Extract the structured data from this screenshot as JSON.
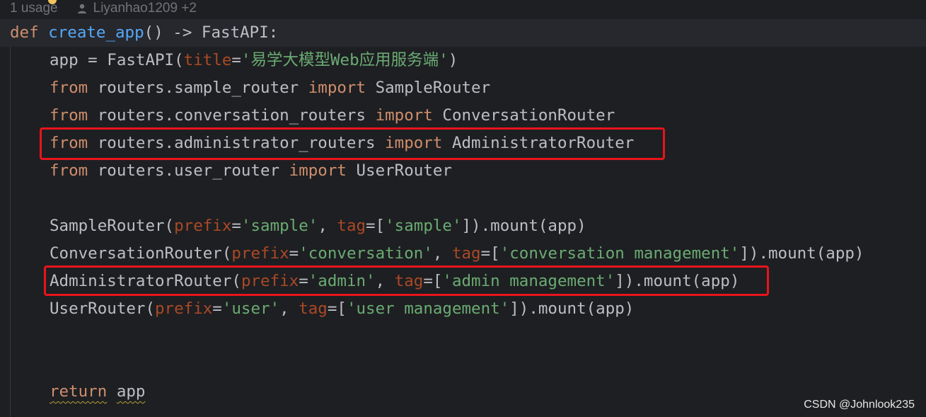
{
  "inlay_hint": {
    "usages": "1 usage",
    "authors": "Liyanhao1209 +2",
    "icons": [
      "bulb-icon",
      "user-icon"
    ]
  },
  "editor": {
    "lines": [
      {
        "tokens": [
          {
            "t": "def",
            "k": "kw"
          },
          {
            "t": " ",
            "k": ""
          },
          {
            "t": "create_app",
            "k": "fn"
          },
          {
            "t": "() -> FastAPI:",
            "k": ""
          }
        ]
      },
      {
        "indent": true,
        "tokens": [
          {
            "t": "app = FastAPI(",
            "k": ""
          },
          {
            "t": "title",
            "k": "param"
          },
          {
            "t": "=",
            "k": ""
          },
          {
            "t": "'",
            "k": "str"
          },
          {
            "t": "易学大模型",
            "k": "str cn"
          },
          {
            "t": "Web",
            "k": "str"
          },
          {
            "t": "应用服务端",
            "k": "str cn"
          },
          {
            "t": "'",
            "k": "str"
          },
          {
            "t": ")",
            "k": ""
          }
        ]
      },
      {
        "indent": true,
        "tokens": [
          {
            "t": "from",
            "k": "kw"
          },
          {
            "t": " routers.sample_router ",
            "k": ""
          },
          {
            "t": "import",
            "k": "kw"
          },
          {
            "t": " SampleRouter",
            "k": ""
          }
        ]
      },
      {
        "indent": true,
        "tokens": [
          {
            "t": "from",
            "k": "kw"
          },
          {
            "t": " routers.conversation_routers ",
            "k": ""
          },
          {
            "t": "import",
            "k": "kw"
          },
          {
            "t": " ConversationRouter",
            "k": ""
          }
        ]
      },
      {
        "indent": true,
        "tokens": [
          {
            "t": "from",
            "k": "kw"
          },
          {
            "t": " routers.administrator_routers ",
            "k": ""
          },
          {
            "t": "import",
            "k": "kw"
          },
          {
            "t": " AdministratorRouter",
            "k": ""
          }
        ]
      },
      {
        "indent": true,
        "tokens": [
          {
            "t": "from",
            "k": "kw"
          },
          {
            "t": " routers.user_router ",
            "k": ""
          },
          {
            "t": "import",
            "k": "kw"
          },
          {
            "t": " UserRouter",
            "k": ""
          }
        ]
      },
      {
        "tokens": []
      },
      {
        "indent": true,
        "tokens": [
          {
            "t": "SampleRouter(",
            "k": ""
          },
          {
            "t": "prefix",
            "k": "param"
          },
          {
            "t": "=",
            "k": ""
          },
          {
            "t": "'sample'",
            "k": "str"
          },
          {
            "t": ", ",
            "k": ""
          },
          {
            "t": "tag",
            "k": "param"
          },
          {
            "t": "=[",
            "k": ""
          },
          {
            "t": "'sample'",
            "k": "str"
          },
          {
            "t": "]).mount(app)",
            "k": ""
          }
        ]
      },
      {
        "indent": true,
        "tokens": [
          {
            "t": "ConversationRouter(",
            "k": ""
          },
          {
            "t": "prefix",
            "k": "param"
          },
          {
            "t": "=",
            "k": ""
          },
          {
            "t": "'conversation'",
            "k": "str"
          },
          {
            "t": ", ",
            "k": ""
          },
          {
            "t": "tag",
            "k": "param"
          },
          {
            "t": "=[",
            "k": ""
          },
          {
            "t": "'conversation management'",
            "k": "str"
          },
          {
            "t": "]).mount(app)",
            "k": ""
          }
        ]
      },
      {
        "indent": true,
        "tokens": [
          {
            "t": "AdministratorRouter(",
            "k": ""
          },
          {
            "t": "prefix",
            "k": "param"
          },
          {
            "t": "=",
            "k": ""
          },
          {
            "t": "'admin'",
            "k": "str"
          },
          {
            "t": ", ",
            "k": ""
          },
          {
            "t": "tag",
            "k": "param"
          },
          {
            "t": "=[",
            "k": ""
          },
          {
            "t": "'admin management'",
            "k": "str"
          },
          {
            "t": "]).mount(app)",
            "k": ""
          }
        ]
      },
      {
        "indent": true,
        "tokens": [
          {
            "t": "UserRouter(",
            "k": ""
          },
          {
            "t": "prefix",
            "k": "param"
          },
          {
            "t": "=",
            "k": ""
          },
          {
            "t": "'user'",
            "k": "str"
          },
          {
            "t": ", ",
            "k": ""
          },
          {
            "t": "tag",
            "k": "param"
          },
          {
            "t": "=[",
            "k": ""
          },
          {
            "t": "'user management'",
            "k": "str"
          },
          {
            "t": "]).mount(app)",
            "k": ""
          }
        ]
      },
      {
        "tokens": []
      },
      {
        "tokens": []
      },
      {
        "indent": true,
        "tokens": [
          {
            "t": "return",
            "k": "kw squiggle"
          },
          {
            "t": " ",
            "k": ""
          },
          {
            "t": "app",
            "k": "squiggle"
          }
        ]
      }
    ]
  },
  "highlights": {
    "color": "#e8141c",
    "boxed_lines": [
      5,
      10
    ]
  },
  "watermark": "CSDN @Johnlook235",
  "colors": {
    "background": "#1e1f22",
    "keyword": "#cf8e6d",
    "function": "#56a8f5",
    "string": "#6aab73",
    "parameter": "#aa4926",
    "text": "#bcbec4"
  }
}
